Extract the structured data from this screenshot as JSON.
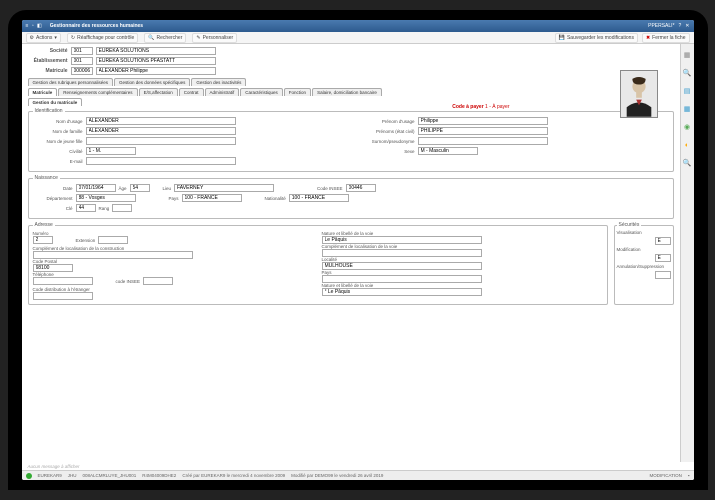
{
  "window": {
    "title": "Gestionnaire des ressources humaines",
    "code_right": "PPERSALI*"
  },
  "toolbar": {
    "actions": "Actions",
    "reaffichage": "Réaffichage pour contrôle",
    "rechercher": "Rechercher",
    "personnaliser": "Personnaliser",
    "sauvegarder": "Sauvegarder les modifications",
    "fermer": "Fermer la fiche"
  },
  "header": {
    "societe_lbl": "Société",
    "societe_code": "001",
    "societe_name": "EURÊKA SOLUTIONS",
    "etab_lbl": "Établissement",
    "etab_code": "001",
    "etab_name": "EURÊKA SOLUTIONS PFASTATT",
    "matricule_lbl": "Matricule",
    "matricule_code": "000006",
    "matricule_name": "ALEXANDER Philippe"
  },
  "code_payer": {
    "label": "Code à payer",
    "value": "1 - À payer"
  },
  "tabs1": {
    "t1": "Gestion des rubriques personnalisées",
    "t2": "Gestion des données spécifiques",
    "t3": "Gestion des inactivités"
  },
  "tabs2": {
    "t1": "Matricule",
    "t2": "Renseignements complémentaires",
    "t3": "E/S,affectation",
    "t4": "Contrat",
    "t5": "Administratif",
    "t6": "Caractéristiques",
    "t7": "Fonction",
    "t8": "Salaire, domiciliation bancaire"
  },
  "tabs3": {
    "t1": "Gestion du matricule"
  },
  "ident": {
    "legend": "Identification",
    "nom_usage_lbl": "Nom d'usage",
    "nom_usage": "ALEXANDER",
    "prenom_usage_lbl": "Prénom d'usage",
    "prenom_usage": "Philippe",
    "nom_famille_lbl": "Nom de famille",
    "nom_famille": "ALEXANDER",
    "prenoms_civil_lbl": "Prénoms (état civil)",
    "prenoms_civil": "PHILIPPE",
    "nom_jeunefille_lbl": "Nom de jeune fille",
    "nom_jeunefille": "",
    "surnom_lbl": "Surnom/pseudonyme",
    "surnom": "",
    "civilite_lbl": "Civilité",
    "civilite": "1 - M.",
    "sexe_lbl": "Sexe",
    "sexe": "M - Masculin",
    "email_lbl": "E-mail",
    "email": ""
  },
  "naiss": {
    "legend": "Naissance",
    "date_lbl": "Date",
    "date": "07/01/1964",
    "age_lbl": "Âge",
    "age": "54",
    "lieu_lbl": "Lieu",
    "lieu": "FAVERNEY",
    "code_insee_lbl": "Code INSEE",
    "code_insee": "00446",
    "dep_lbl": "Département",
    "dep": "88 - Vosges",
    "pays_lbl": "Pays",
    "pays": "100 - FRANCE",
    "nat_lbl": "Nationalité",
    "nat": "100 - FRANCE",
    "cle_lbl": "Clé",
    "cle": "44",
    "rang_lbl": "Rang",
    "rang": ""
  },
  "adr": {
    "legend": "Adresse",
    "numero_lbl": "Numéro",
    "numero": "2",
    "ext_lbl": "Extension",
    "ext": "",
    "nature_lbl": "Nature et libellé de la voie",
    "nature": "Le Pâquis",
    "compl1_lbl": "Complément de localisation de la construction",
    "compl1": "",
    "compl2_lbl": "Complément de localisation de la voie",
    "compl2": "",
    "cp_lbl": "Code Postal",
    "cp": "68100",
    "localite_lbl": "Localité",
    "localite": "MULHOUSE",
    "tel_lbl": "Téléphone",
    "tel": "",
    "code_insee2_lbl": "code INSEE",
    "code_insee2": "",
    "pays2_lbl": "Pays",
    "pays2": "",
    "code_dist_lbl": "Code distribution à l'étranger",
    "code_dist": "",
    "nature2_lbl": "Nature et libellé de la voie",
    "nature2": "° Le Pâquis"
  },
  "sec": {
    "legend": "Sécurités",
    "vis_lbl": "Visualisation",
    "vis": "E",
    "mod_lbl": "Modification",
    "mod": "E",
    "ann_lbl": "Annulation/Suppression",
    "ann": ""
  },
  "msg": "Aucun message à afficher",
  "status": {
    "s1": "EUREKAR9",
    "s2": "JHU",
    "s3": "008ALCMRLUYE_JHU001",
    "s4": "R4M04009DHE2",
    "s5": "Créé par EUREKAR9 le mercredi 4 novembre 2009",
    "s6": "Modifié par DEMO99 le vendredi 26 avril 2019",
    "s7": "MODIFICATION"
  }
}
